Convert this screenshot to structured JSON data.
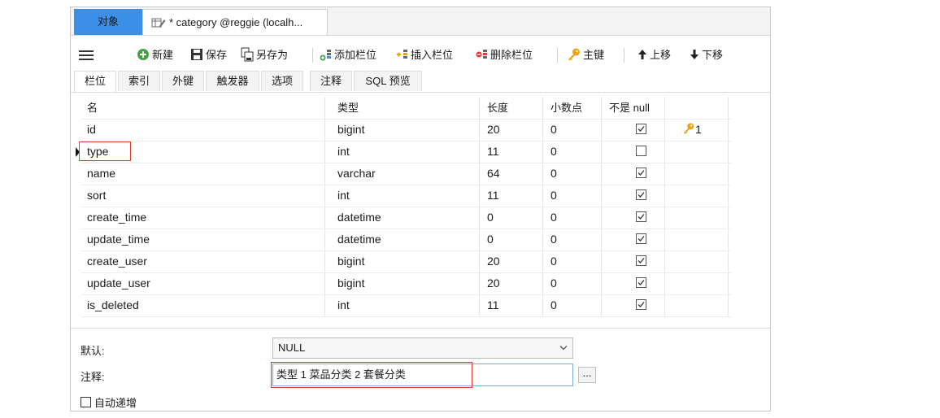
{
  "tabs": {
    "objects": "对象",
    "active": "* category @reggie (localh..."
  },
  "toolbar": {
    "new": "新建",
    "save": "保存",
    "save_as": "另存为",
    "add_field": "添加栏位",
    "insert_field": "插入栏位",
    "delete_field": "删除栏位",
    "primary_key": "主键",
    "move_up": "上移",
    "move_down": "下移"
  },
  "subtabs": [
    "栏位",
    "索引",
    "外键",
    "触发器",
    "选项",
    "注释",
    "SQL 预览"
  ],
  "columns": {
    "name": "名",
    "type": "类型",
    "length": "长度",
    "decimals": "小数点",
    "not_null": "不是 null"
  },
  "fields": [
    {
      "name": "id",
      "type": "bigint",
      "length": "20",
      "decimals": "0",
      "not_null": true,
      "key": "1"
    },
    {
      "name": "type",
      "type": "int",
      "length": "11",
      "decimals": "0",
      "not_null": false,
      "key": ""
    },
    {
      "name": "name",
      "type": "varchar",
      "length": "64",
      "decimals": "0",
      "not_null": true,
      "key": ""
    },
    {
      "name": "sort",
      "type": "int",
      "length": "11",
      "decimals": "0",
      "not_null": true,
      "key": ""
    },
    {
      "name": "create_time",
      "type": "datetime",
      "length": "0",
      "decimals": "0",
      "not_null": true,
      "key": ""
    },
    {
      "name": "update_time",
      "type": "datetime",
      "length": "0",
      "decimals": "0",
      "not_null": true,
      "key": ""
    },
    {
      "name": "create_user",
      "type": "bigint",
      "length": "20",
      "decimals": "0",
      "not_null": true,
      "key": ""
    },
    {
      "name": "update_user",
      "type": "bigint",
      "length": "20",
      "decimals": "0",
      "not_null": true,
      "key": ""
    },
    {
      "name": "is_deleted",
      "type": "int",
      "length": "11",
      "decimals": "0",
      "not_null": true,
      "key": ""
    }
  ],
  "panel": {
    "default_label": "默认:",
    "default_value": "NULL",
    "comment_label": "注释:",
    "comment_value": "类型   1 菜品分类 2 套餐分类",
    "dots_label": "...",
    "auto_increment_label": "自动递增"
  },
  "colors": {
    "accent_tab": "#3c8fe7",
    "highlight_border": "#e03b2e",
    "key_icon": "#e8a317"
  }
}
